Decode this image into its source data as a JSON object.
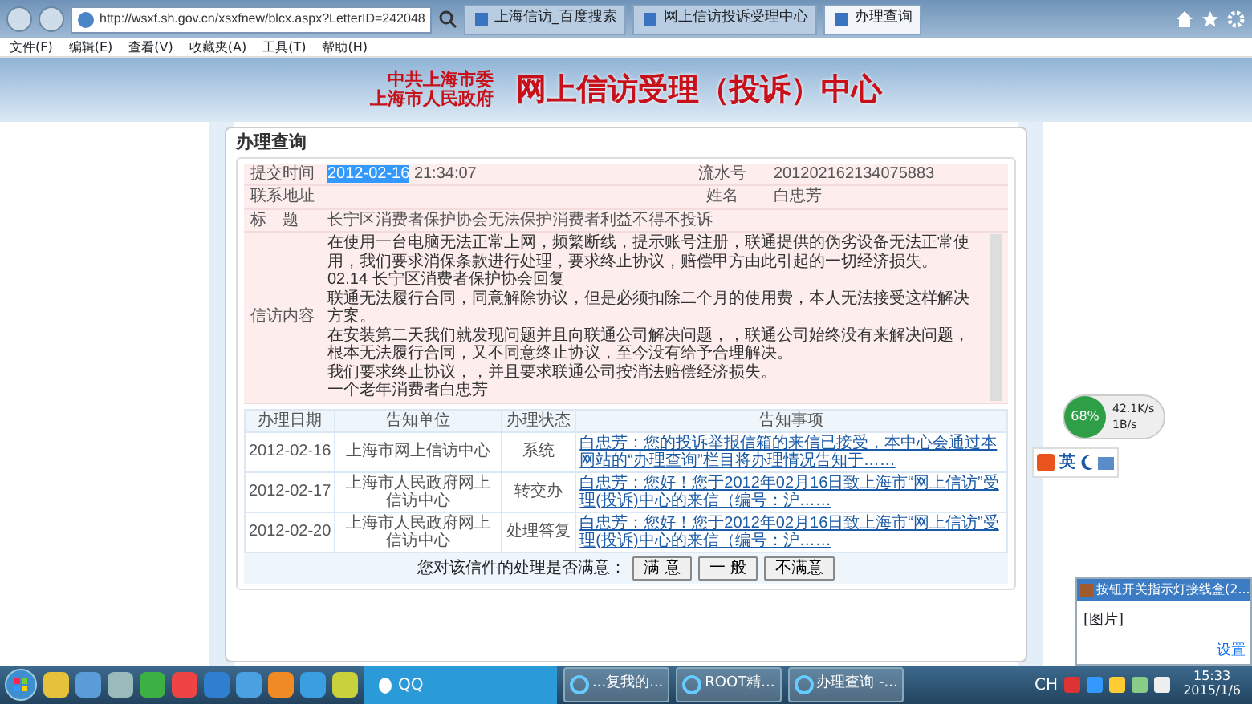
{
  "browser": {
    "url": "http://wsxf.sh.gov.cn/xsxfnew/blcx.aspx?LetterID=242048",
    "tabs": [
      {
        "label": "上海信访_百度搜索",
        "selected": false
      },
      {
        "label": "网上信访投诉受理中心",
        "selected": false
      },
      {
        "label": "办理查询",
        "selected": true
      }
    ],
    "menu": [
      "文件(F)",
      "编辑(E)",
      "查看(V)",
      "收藏夹(A)",
      "工具(T)",
      "帮助(H)"
    ]
  },
  "banner": {
    "org": "中共上海市委",
    "gov": "上海市人民政府",
    "title": "网上信访受理（投诉）中心"
  },
  "panel": {
    "title": "办理查询",
    "letter": {
      "submit_label": "提交时间",
      "submit_date": "2012-02-16",
      "date_selected": true,
      "submit_time": "21:34:07",
      "serial_label": "流水号",
      "serial": "201202162134075883",
      "address_label": "联系地址",
      "name_label": "姓名",
      "name": "白忠芳",
      "subject_label": "标　题",
      "subject": "长宁区消费者保护协会无法保护消费者利益不得不投诉",
      "content_label": "信访内容",
      "content": [
        "在使用一台电脑无法正常上网，频繁断线，提示账号注册，联通提供的伪劣设备无法正常使用，我们要求消保条款进行处理，要求终止协议，赔偿甲方由此引起的一切经济损失。",
        "02.14 长宁区消费者保护协会回复",
        "联通无法履行合同，同意解除协议，但是必须扣除二个月的使用费，本人无法接受这样解决方案。",
        "在安装第二天我们就发现问题并且向联通公司解决问题，，联通公司始终没有来解决问题，根本无法履行合同，又不同意终止协议，至今没有给予合理解决。",
        "我们要求终止协议，，并且要求联通公司按消法赔偿经济损失。",
        "一个老年消费者白忠芳"
      ]
    },
    "history": {
      "columns": [
        "办理日期",
        "告知单位",
        "办理状态",
        "告知事项"
      ],
      "rows": [
        {
          "date": "2012-02-16",
          "unit": "上海市网上信访中心",
          "status": "系统",
          "notice": "白忠芳：您的投诉举报信箱的来信已接受，本中心会通过本网站的“办理查询”栏目将办理情况告知于……"
        },
        {
          "date": "2012-02-17",
          "unit": "上海市人民政府网上信访中心",
          "status": "转交办",
          "notice": "白忠芳：您好！您于2012年02月16日致上海市“网上信访”受理(投诉)中心的来信（编号：沪……"
        },
        {
          "date": "2012-02-20",
          "unit": "上海市人民政府网上信访中心",
          "status": "处理答复",
          "notice": "白忠芳：您好！您于2012年02月16日致上海市“网上信访”受理(投诉)中心的来信（编号：沪……"
        }
      ]
    },
    "satisfaction": {
      "prompt": "您对该信件的处理是否满意：",
      "buttons": [
        "满 意",
        "一 般",
        "不满意"
      ]
    }
  },
  "ime": {
    "label": "英"
  },
  "network": {
    "percent": "68%",
    "up": "42.1K/s",
    "down": "1B/s"
  },
  "notification": {
    "title": "按钮开关指示灯接线盒(2...",
    "body": "[图片]",
    "settings": "设置"
  },
  "taskbar": {
    "qq": "QQ",
    "tasks": [
      "...复我的...",
      "ROOT精...",
      "办理查询 -..."
    ],
    "lang": "CH",
    "time": "15:33",
    "date": "2015/1/6"
  }
}
